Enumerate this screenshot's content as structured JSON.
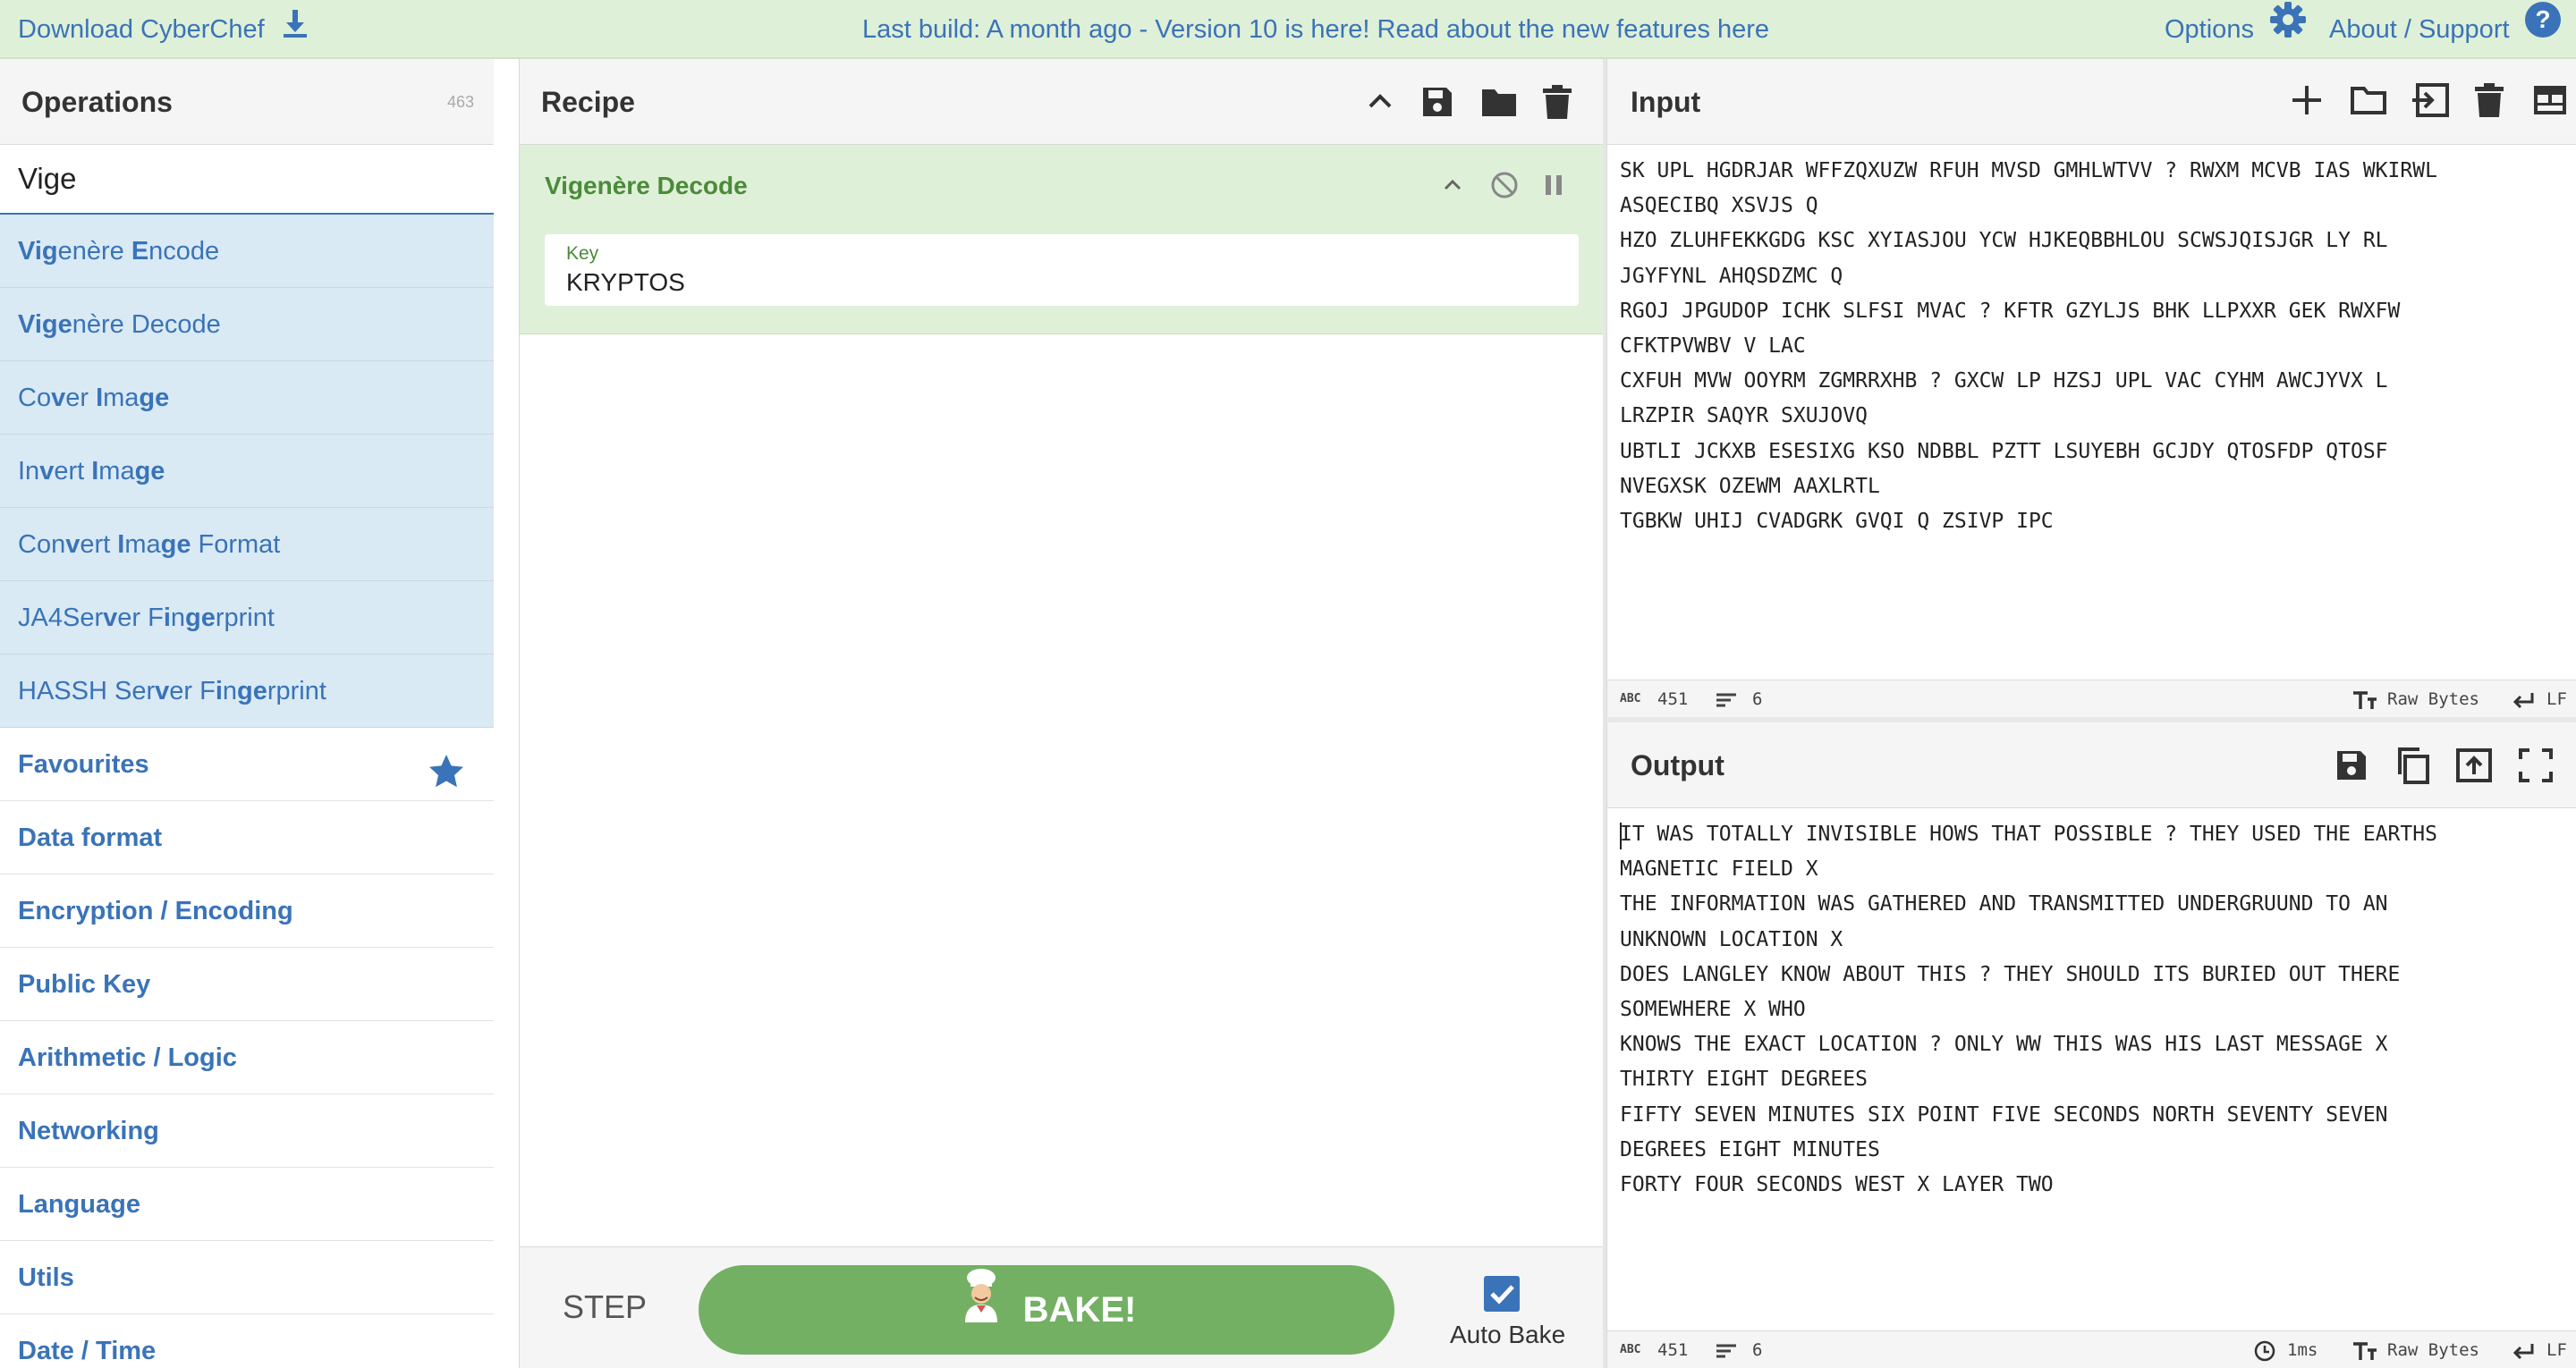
{
  "banner": {
    "download_label": "Download CyberChef",
    "build_message": "Last build: A month ago - Version 10 is here! Read about the new features here",
    "options_label": "Options",
    "about_label": "About / Support"
  },
  "operations": {
    "title": "Operations",
    "count": "463",
    "search_value": "Vige",
    "results": [
      {
        "pre": "",
        "b1": "Vig",
        "mid": "",
        "b2": "",
        "mid2": "",
        "b3": "",
        "tail": "enère ",
        "b4": "E",
        "tail2": "ncode"
      },
      {
        "pre": "",
        "b1": "Vige",
        "mid": "",
        "b2": "",
        "mid2": "",
        "b3": "",
        "tail": "nère Decode",
        "b4": "",
        "tail2": ""
      },
      {
        "pre": "Co",
        "b1": "v",
        "mid": "er ",
        "b2": "I",
        "mid2": "ma",
        "b3": "ge",
        "tail": "",
        "b4": "",
        "tail2": ""
      },
      {
        "pre": "In",
        "b1": "v",
        "mid": "ert ",
        "b2": "I",
        "mid2": "ma",
        "b3": "ge",
        "tail": "",
        "b4": "",
        "tail2": ""
      },
      {
        "pre": "Con",
        "b1": "v",
        "mid": "ert ",
        "b2": "I",
        "mid2": "ma",
        "b3": "ge",
        "tail": " Format",
        "b4": "",
        "tail2": ""
      },
      {
        "pre": "JA4Ser",
        "b1": "v",
        "mid": "er F",
        "b2": "i",
        "mid2": "n",
        "b3": "ge",
        "tail": "rprint",
        "b4": "",
        "tail2": ""
      },
      {
        "pre": "HASSH Ser",
        "b1": "v",
        "mid": "er F",
        "b2": "i",
        "mid2": "n",
        "b3": "ge",
        "tail": "rprint",
        "b4": "",
        "tail2": ""
      }
    ],
    "categories": [
      "Favourites",
      "Data format",
      "Encryption / Encoding",
      "Public Key",
      "Arithmetic / Logic",
      "Networking",
      "Language",
      "Utils",
      "Date / Time"
    ]
  },
  "recipe": {
    "title": "Recipe",
    "operation_title": "Vigenère Decode",
    "key_label": "Key",
    "key_value": "KRYPTOS",
    "step_label": "STEP",
    "bake_label": "BAKE!",
    "autobake_label": "Auto Bake",
    "autobake_checked": true
  },
  "input": {
    "title": "Input",
    "text": "SK UPL HGDRJAR WFFZQXUZW RFUH MVSD GMHLWTVV ? RWXM MCVB IAS WKIRWL\nASQECIBQ XSVJS Q\nHZO ZLUHFEKKGDG KSC XYIASJOU YCW HJKEQBBHLOU SCWSJQISJGR LY RL\nJGYFYNL AHQSDZMC Q\nRGOJ JPGUDOP ICHK SLFSI MVAC ? KFTR GZYLJS BHK LLPXXR GEK RWXFW\nCFKTPVWBV V LAC\nCXFUH MVW OOYRM ZGMRRXHB ? GXCW LP HZSJ UPL VAC CYHM AWCJYVX L\nLRZPIR SAQYR SXUJOVQ\nUBTLI JCKXB ESESIXG KSO NDBBL PZTT LSUYEBH GCJDY QTOSFDP QTOSF\nNVEGXSK OZEWM AAXLRTL\nTGBKW UHIJ CVADGRK GVQI Q ZSIVP IPC",
    "char_count": "451",
    "line_count": "6",
    "encoding": "Raw Bytes",
    "eol": "LF"
  },
  "output": {
    "title": "Output",
    "text": "IT WAS TOTALLY INVISIBLE HOWS THAT POSSIBLE ? THEY USED THE EARTHS\nMAGNETIC FIELD X\nTHE INFORMATION WAS GATHERED AND TRANSMITTED UNDERGRUUND TO AN\nUNKNOWN LOCATION X\nDOES LANGLEY KNOW ABOUT THIS ? THEY SHOULD ITS BURIED OUT THERE\nSOMEWHERE X WHO\nKNOWS THE EXACT LOCATION ? ONLY WW THIS WAS HIS LAST MESSAGE X\nTHIRTY EIGHT DEGREES\nFIFTY SEVEN MINUTES SIX POINT FIVE SECONDS NORTH SEVENTY SEVEN\nDEGREES EIGHT MINUTES\nFORTY FOUR SECONDS WEST X LAYER TWO",
    "char_count": "451",
    "line_count": "6",
    "time": "1ms",
    "encoding": "Raw Bytes",
    "eol": "LF"
  },
  "icons": {
    "download": "download-icon",
    "options": "gear-icon",
    "about": "help-icon",
    "star": "star-icon",
    "accent": "#3a73b8",
    "recipe_green": "#4a8b3a",
    "bake_green": "#73b063",
    "banner_bg": "#dff0d8",
    "result_bg": "#d9eaf5"
  }
}
